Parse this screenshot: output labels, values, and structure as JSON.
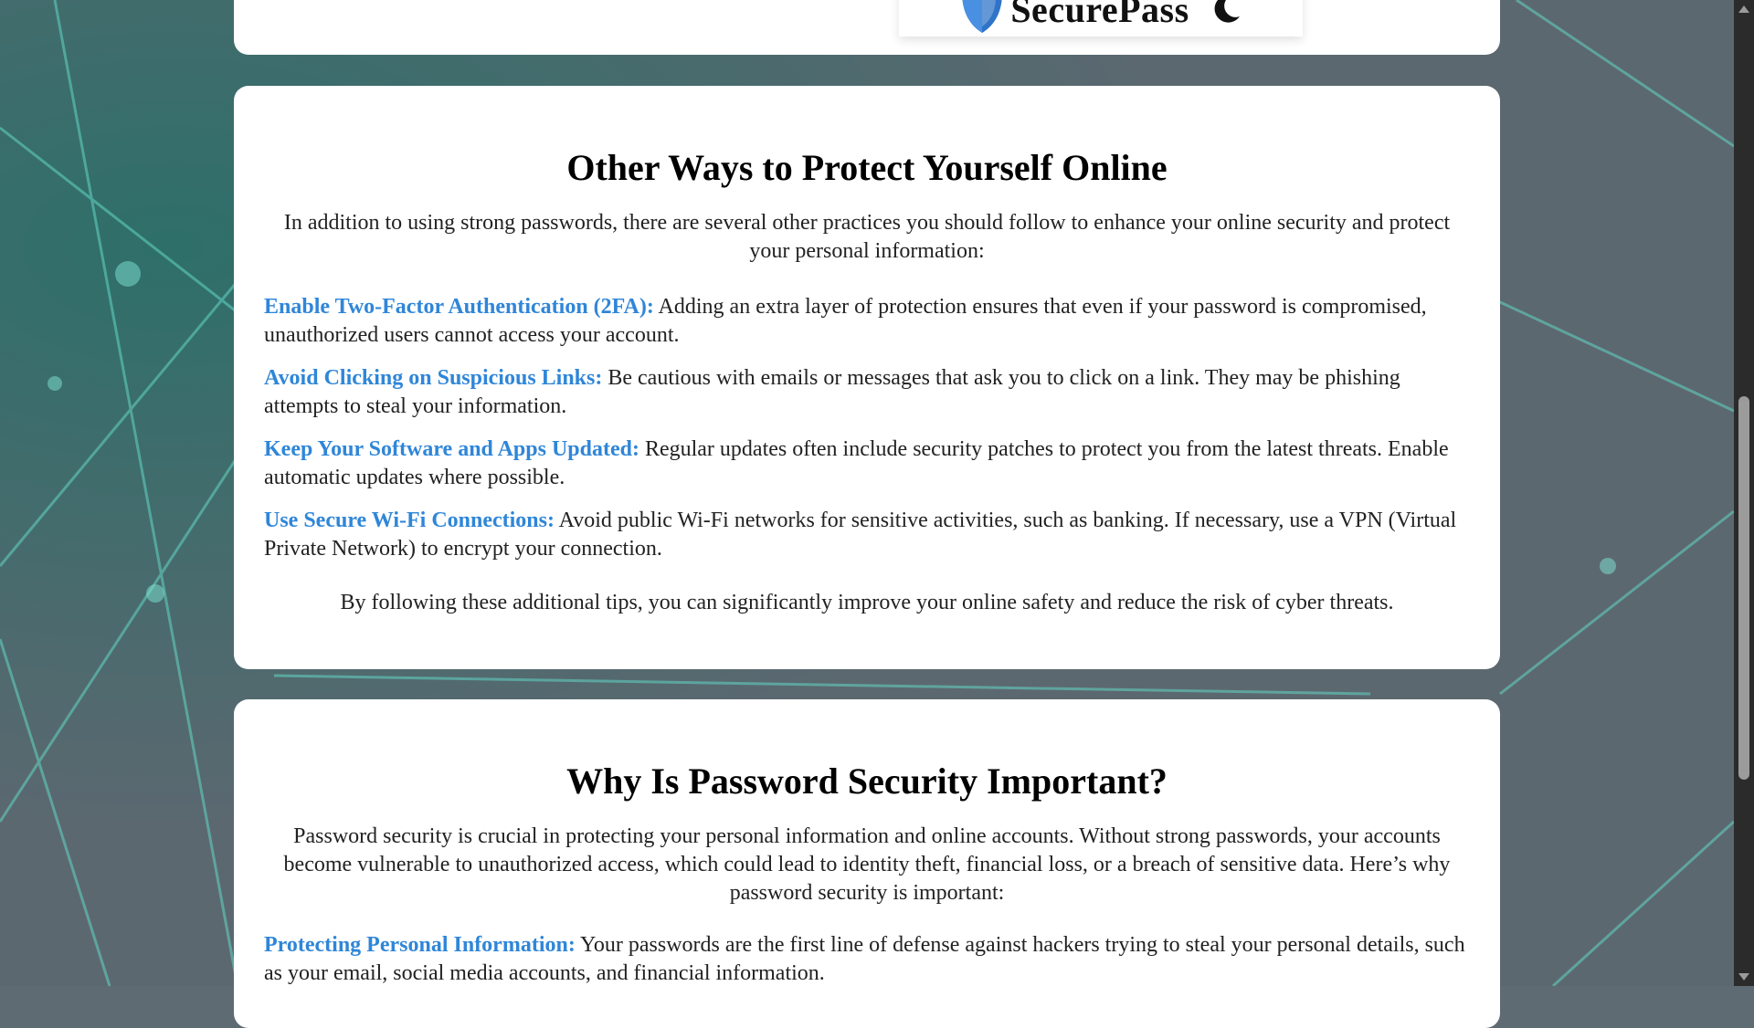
{
  "brand": {
    "name": "SecurePass",
    "logo_icon": "shield-icon",
    "theme_icon": "moon-icon"
  },
  "colors": {
    "accent": "#2f86d8",
    "card": "#ffffff",
    "text": "#222222"
  },
  "section_other": {
    "title": "Other Ways to Protect Yourself Online",
    "intro": "In addition to using strong passwords, there are several other practices you should follow to enhance your online security and protect your personal information:",
    "items": [
      {
        "term": "Enable Two-Factor Authentication (2FA):",
        "text": " Adding an extra layer of protection ensures that even if your password is compromised, unauthorized users cannot access your account."
      },
      {
        "term": "Avoid Clicking on Suspicious Links:",
        "text": " Be cautious with emails or messages that ask you to click on a link. They may be phishing attempts to steal your information."
      },
      {
        "term": "Keep Your Software and Apps Updated:",
        "text": " Regular updates often include security patches to protect you from the latest threats. Enable automatic updates where possible."
      },
      {
        "term": "Use Secure Wi-Fi Connections:",
        "text": " Avoid public Wi-Fi networks for sensitive activities, such as banking. If necessary, use a VPN (Virtual Private Network) to encrypt your connection."
      }
    ],
    "outro": "By following these additional tips, you can significantly improve your online safety and reduce the risk of cyber threats."
  },
  "section_why": {
    "title": "Why Is Password Security Important?",
    "intro": "Password security is crucial in protecting your personal information and online accounts. Without strong passwords, your accounts become vulnerable to unauthorized access, which could lead to identity theft, financial loss, or a breach of sensitive data. Here’s why password security is important:",
    "items": [
      {
        "term": "Protecting Personal Information:",
        "text": " Your passwords are the first line of defense against hackers trying to steal your personal details, such as your email, social media accounts, and financial information."
      }
    ]
  }
}
